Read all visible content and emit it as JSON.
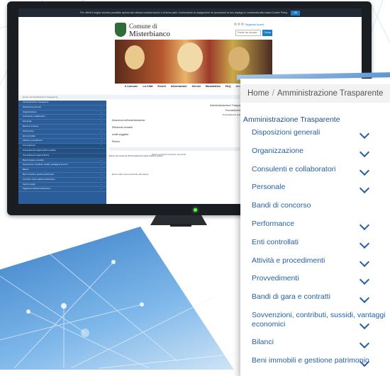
{
  "cookie_bar": {
    "text": "Per offrirti il miglior servizio possibile questo sito utilizza cookies tecnici e di terze parti. Continuando la navigazione ne acconsenti al loro impiego in conformità alla nostra Cookie Policy",
    "ok_label": "Ok"
  },
  "header": {
    "city_line1": "Comune di",
    "city_line2": "Misterbianco",
    "register_label": "Registrati",
    "login_label": "Accedi",
    "search_placeholder": "Parole da cercare",
    "search_button": "Cerca"
  },
  "top_nav": [
    "Il Comune",
    "La Città",
    "Eventi",
    "Informazioni",
    "Servizi",
    "Modulistica",
    "FAQ",
    "Amministrazione Trasparente"
  ],
  "small_sidebar": [
    "Amministrazione Trasparente",
    "Disposizioni generali",
    "Organizzazione",
    "Consulenti e collaboratori",
    "Personale",
    "Bandi di concorso",
    "Performance",
    "Enti controllati",
    "Attività e procedimenti",
    "Provvedimenti",
    "Provvedimenti organi indirizzo politico",
    "Provvedimenti organi indirizzo",
    "Bandi di gara e contratti",
    "Sovvenzioni, contributi, sussidi, vantaggi economici",
    "Bilanci",
    "Beni immobili e gestione patrimonio",
    "Controlli e rilievi sull'amministrazione",
    "Servizi erogati",
    "Pagamenti dell'amministrazione"
  ],
  "small_main": {
    "title": "Amministrazione Trasparente",
    "subtitle": "Provvedimenti",
    "sub2": "Provvedimenti organi indirizzo politico",
    "opts": [
      "Descrizione dell'amministrazione",
      "Riferimenti normativi",
      "Ambiti soggettivi",
      "Ricerca"
    ],
    "table_header": "Elenco dei contenuti di Provvedimenti organi indirizzo politico",
    "table_empty": "Nessun contenuto presente nel portale",
    "footnote": "Elenco delle risorse associate alla pagina"
  },
  "zoom": {
    "breadcrumb_home": "Home",
    "breadcrumb_sep": "/",
    "breadcrumb_current": "Amministrazione Trasparente",
    "section_title": "Amministrazione Trasparente",
    "items": [
      {
        "label": "Disposizioni generali",
        "has_chevron": true
      },
      {
        "label": "Organizzazione",
        "has_chevron": true
      },
      {
        "label": "Consulenti e collaboratori",
        "has_chevron": true
      },
      {
        "label": "Personale",
        "has_chevron": true
      },
      {
        "label": "Bandi di concorso",
        "has_chevron": false
      },
      {
        "label": "Performance",
        "has_chevron": true
      },
      {
        "label": "Enti controllati",
        "has_chevron": true
      },
      {
        "label": "Attività e procedimenti",
        "has_chevron": true
      },
      {
        "label": "Provvedimenti",
        "has_chevron": true
      },
      {
        "label": "Bandi di gara e contratti",
        "has_chevron": true
      },
      {
        "label": "Sovvenzioni, contributi, sussidi, vantaggi economici",
        "has_chevron": true
      },
      {
        "label": "Bilanci",
        "has_chevron": true
      },
      {
        "label": "Beni immobili e gestione patrimonio",
        "has_chevron": true
      }
    ]
  },
  "colors": {
    "link_blue": "#2560a6",
    "sidebar_blue": "#2a5d99",
    "accent": "#1c7fc6",
    "led": "#58ff48"
  }
}
